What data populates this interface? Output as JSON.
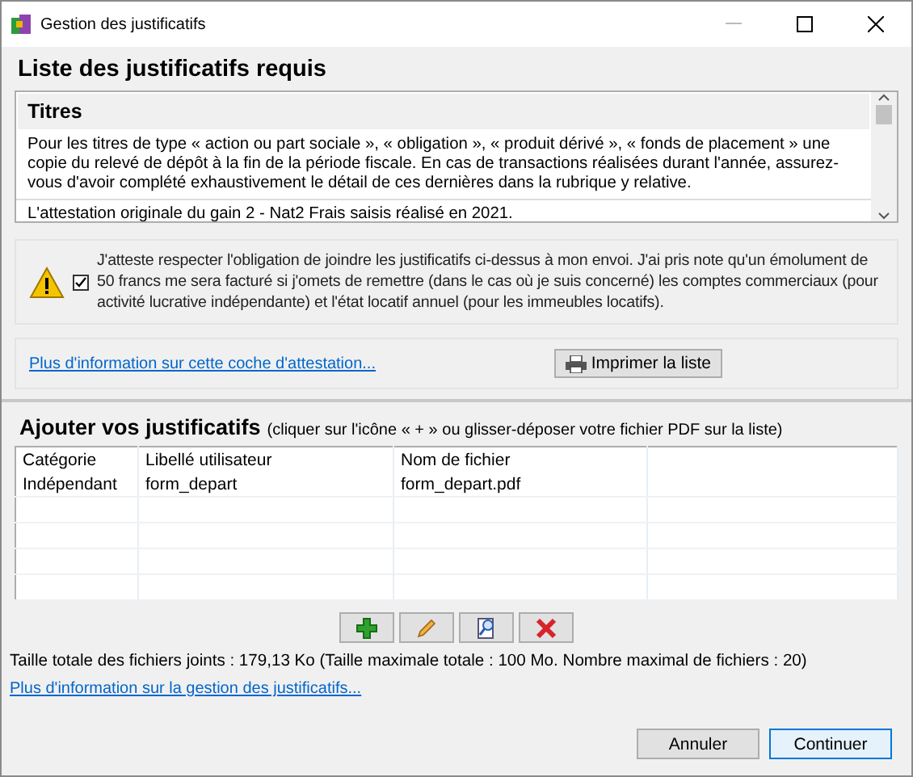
{
  "window": {
    "title": "Gestion des justificatifs"
  },
  "required": {
    "heading": "Liste des justificatifs requis",
    "section_title": "Titres",
    "items": [
      "Pour les titres de type « action ou part sociale », « obligation », « produit dérivé », « fonds de placement » une copie du relevé de dépôt à la fin de la période fiscale. En cas de transactions réalisées durant l'année, assurez-vous d'avoir complété exhaustivement le détail de ces dernières dans la rubrique y relative.",
      "L'attestation originale du gain 2 - Nat2 Frais saisis réalisé en 2021."
    ]
  },
  "attestation": {
    "checked": true,
    "text": "J'atteste respecter l'obligation de joindre les justificatifs ci-dessus à mon envoi. J'ai pris note qu'un émolument de 50 francs me sera facturé si j'omets de remettre (dans le cas où je suis concerné) les comptes commerciaux (pour activité lucrative indépendante) et l'état locatif annuel (pour les immeubles locatifs)."
  },
  "attestation_link": "Plus d'information sur cette coche d'attestation...",
  "print_button": "Imprimer la liste",
  "add": {
    "heading": "Ajouter vos justificatifs",
    "hint": "(cliquer sur l'icône « + » ou glisser-déposer votre fichier PDF sur la liste)"
  },
  "table": {
    "columns": [
      "Catégorie",
      "Libellé utilisateur",
      "Nom de fichier"
    ],
    "rows": [
      [
        "Indépendant",
        "form_depart",
        "form_depart.pdf"
      ]
    ]
  },
  "toolbar": [
    {
      "kind": "add"
    },
    {
      "kind": "edit"
    },
    {
      "kind": "view"
    },
    {
      "kind": "delete"
    }
  ],
  "size_info": "Taille totale des fichiers joints : 179,13 Ko (Taille maximale totale : 100 Mo. Nombre maximal de fichiers : 20)",
  "help_link": "Plus d'information sur la gestion des justificatifs...",
  "buttons": [
    {
      "label": "Annuler",
      "selected": false
    },
    {
      "label": "Continuer",
      "selected": true
    }
  ]
}
